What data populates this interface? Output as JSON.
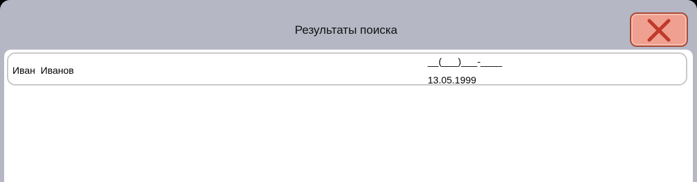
{
  "dialog": {
    "title": "Результаты поиска",
    "close_icon": "close-icon",
    "colors": {
      "background": "#b5b7c4",
      "close_button": "#f0a090",
      "close_border": "#a84a38",
      "close_x": "#c0392b",
      "panel": "#ffffff",
      "row_border": "#c9c9c9"
    }
  },
  "results": [
    {
      "name": "Иван  Иванов",
      "phone": "__(___)___-____",
      "birth_date": "13.05.1999"
    }
  ]
}
